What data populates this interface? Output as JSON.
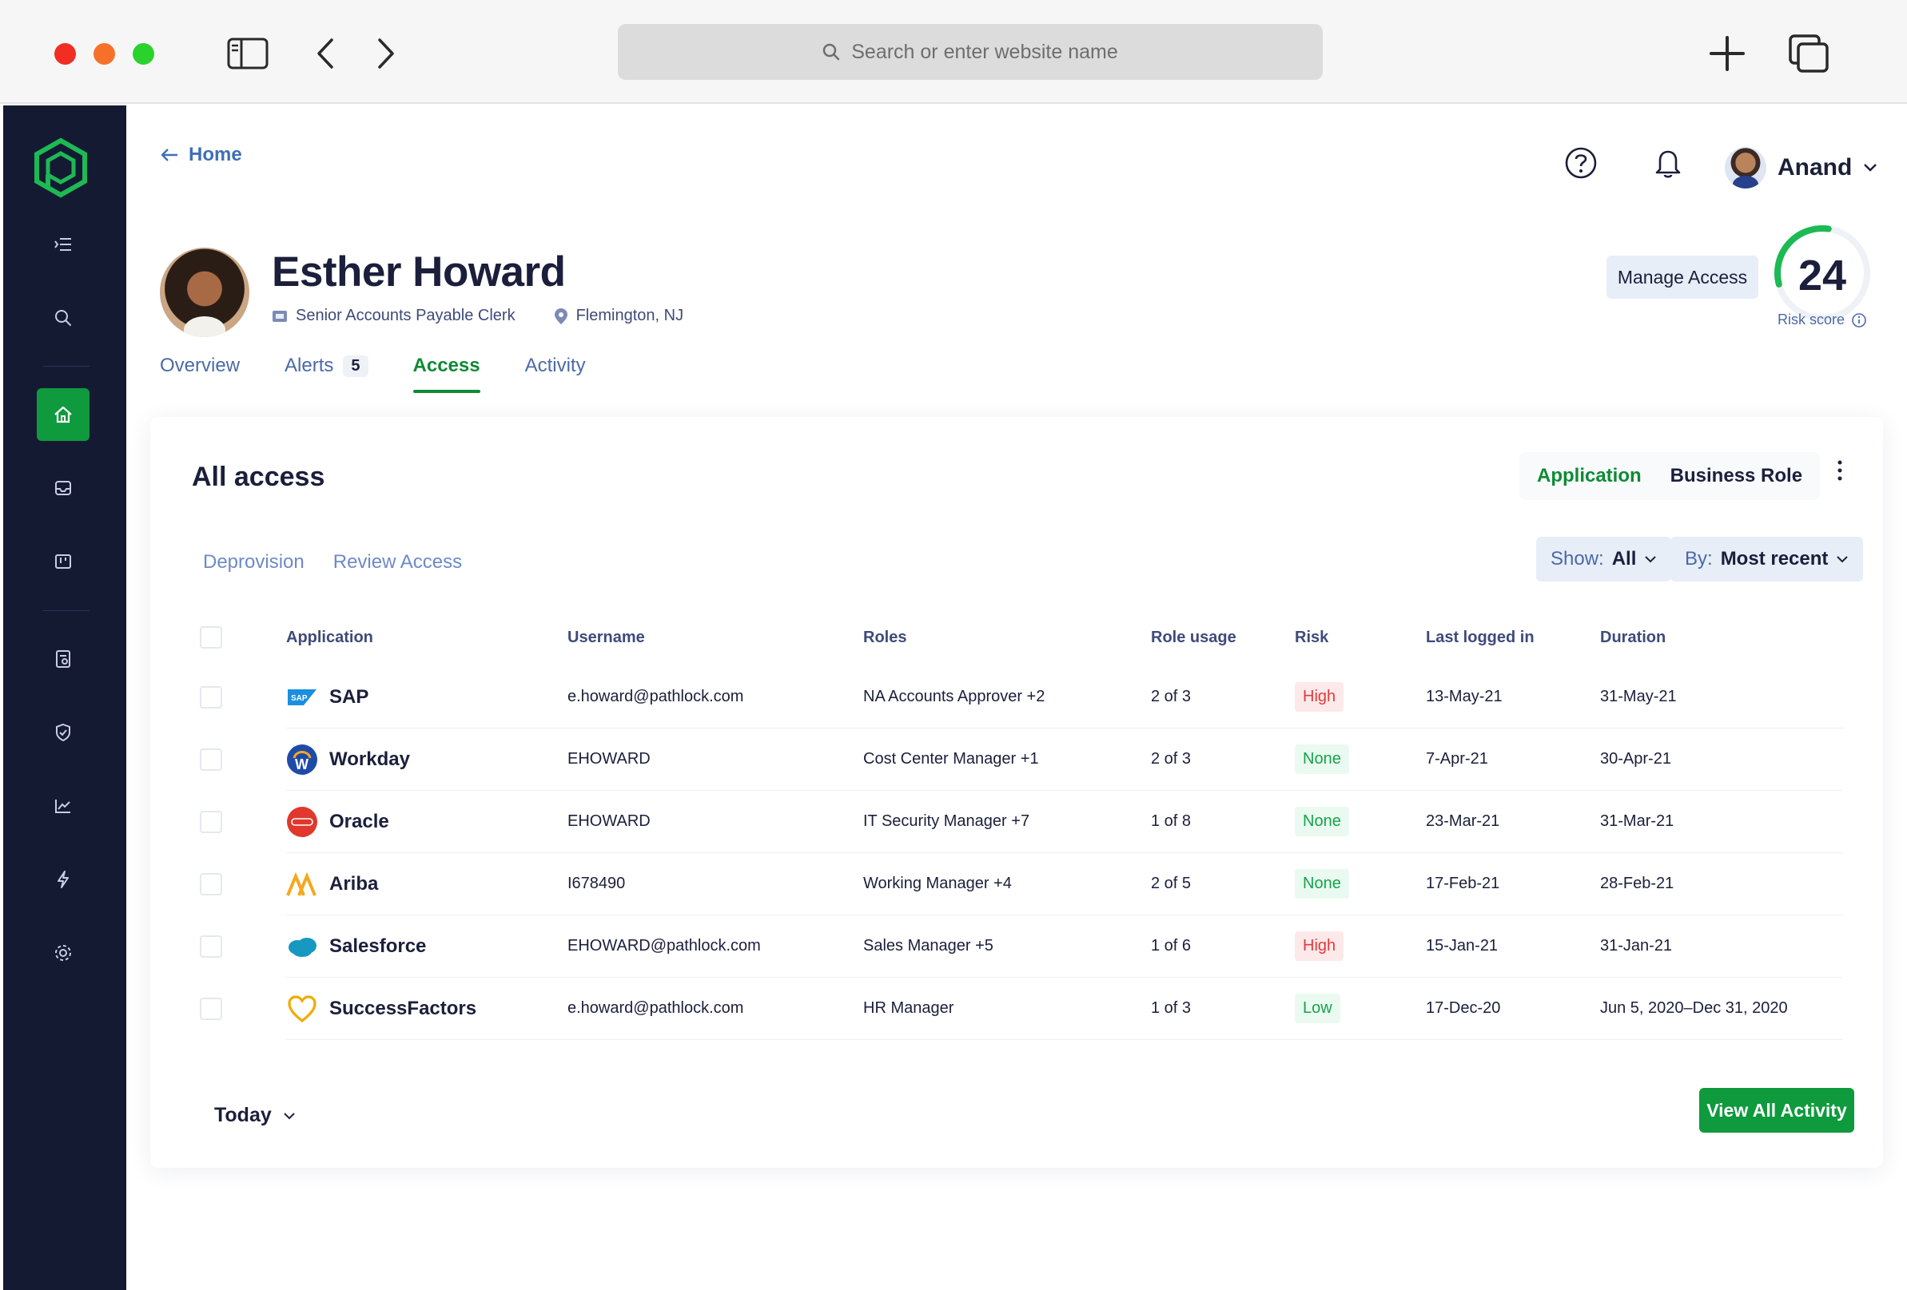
{
  "browser": {
    "url_placeholder": "Search or enter website name"
  },
  "header": {
    "back_label": "Home",
    "user_name": "Anand"
  },
  "profile": {
    "name": "Esther Howard",
    "title": "Senior Accounts Payable Clerk",
    "location": "Flemington, NJ",
    "manage_access_label": "Manage Access",
    "risk_score": "24",
    "risk_score_value": 24,
    "risk_label": "Risk score"
  },
  "tabs": [
    {
      "label": "Overview",
      "active": false
    },
    {
      "label": "Alerts",
      "count": "5",
      "active": false
    },
    {
      "label": "Access",
      "active": true
    },
    {
      "label": "Activity",
      "active": false
    }
  ],
  "access": {
    "title": "All access",
    "toggle": {
      "application": "Application",
      "business_role": "Business Role",
      "selected": "Application"
    },
    "subtabs": [
      "Deprovision",
      "Review Access"
    ],
    "show_filter": {
      "label": "Show:",
      "value": "All"
    },
    "sort_filter": {
      "label": "By:",
      "value": "Most recent"
    },
    "columns": [
      "Application",
      "Username",
      "Roles",
      "Role usage",
      "Risk",
      "Last logged in",
      "Duration"
    ],
    "rows": [
      {
        "app": "SAP",
        "icon": "sap-logo-icon",
        "username": "e.howard@pathlock.com",
        "roles": "NA Accounts Approver +2",
        "usage": "2 of 3",
        "risk": "High",
        "last": "13-May-21",
        "duration": "31-May-21"
      },
      {
        "app": "Workday",
        "icon": "workday-logo-icon",
        "username": "EHOWARD",
        "roles": "Cost Center Manager +1",
        "usage": "2 of 3",
        "risk": "None",
        "last": "7-Apr-21",
        "duration": "30-Apr-21"
      },
      {
        "app": "Oracle",
        "icon": "oracle-logo-icon",
        "username": "EHOWARD",
        "roles": "IT Security Manager +7",
        "usage": "1 of 8",
        "risk": "None",
        "last": "23-Mar-21",
        "duration": "31-Mar-21"
      },
      {
        "app": "Ariba",
        "icon": "ariba-logo-icon",
        "username": "I678490",
        "roles": "Working Manager +4",
        "usage": "2 of 5",
        "risk": "None",
        "last": "17-Feb-21",
        "duration": "28-Feb-21"
      },
      {
        "app": "Salesforce",
        "icon": "salesforce-logo-icon",
        "username": "EHOWARD@pathlock.com",
        "roles": "Sales Manager +5",
        "usage": "1 of 6",
        "risk": "High",
        "last": "15-Jan-21",
        "duration": "31-Jan-21"
      },
      {
        "app": "SuccessFactors",
        "icon": "successfactors-logo-icon",
        "username": "e.howard@pathlock.com",
        "roles": "HR Manager",
        "usage": "1 of 3",
        "risk": "Low",
        "last": "17-Dec-20",
        "duration": "Jun 5, 2020–Dec 31, 2020"
      }
    ],
    "period_label": "Today",
    "view_all_label": "View All Activity"
  },
  "colors": {
    "sidebar_bg": "#151a33",
    "accent_green": "#0e9a3d",
    "risk_high": "#e23b3b",
    "risk_ok": "#16a34a",
    "link_blue": "#4a6aa6"
  }
}
